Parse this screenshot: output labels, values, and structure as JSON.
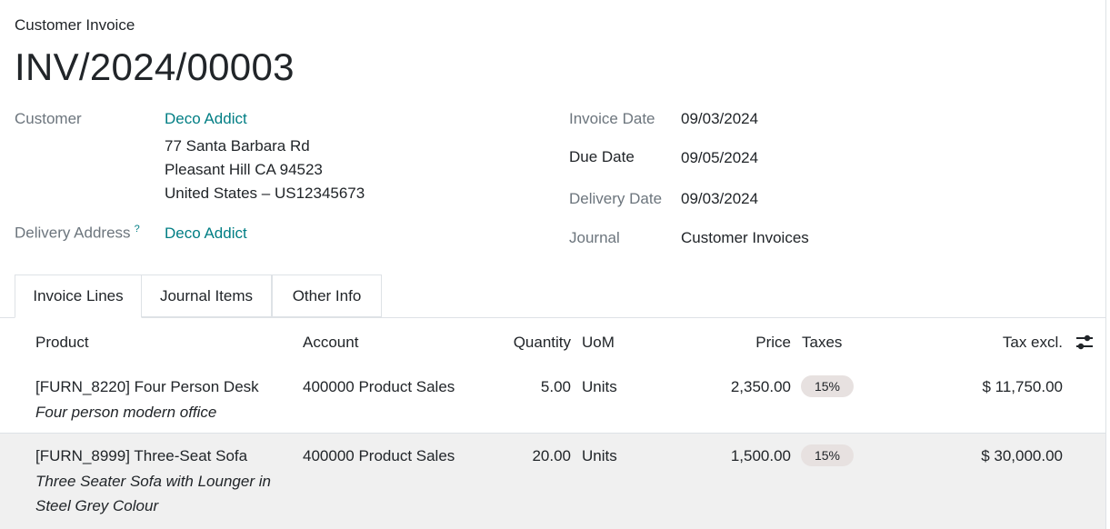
{
  "header": {
    "doc_kind": "Customer Invoice",
    "doc_name": "INV/2024/00003"
  },
  "customer": {
    "label": "Customer",
    "name": "Deco Addict",
    "address_line1": "77 Santa Barbara Rd",
    "address_line2": "Pleasant Hill CA 94523",
    "address_line3": "United States – US12345673"
  },
  "delivery_address": {
    "label": "Delivery Address",
    "help": "?",
    "value": "Deco Addict"
  },
  "invoice_date": {
    "label": "Invoice Date",
    "value": "09/03/2024"
  },
  "due_date": {
    "label": "Due Date",
    "value": "09/05/2024"
  },
  "delivery_date": {
    "label": "Delivery Date",
    "value": "09/03/2024"
  },
  "journal": {
    "label": "Journal",
    "value": "Customer Invoices"
  },
  "tabs": [
    {
      "label": "Invoice Lines",
      "active": true
    },
    {
      "label": "Journal Items",
      "active": false
    },
    {
      "label": "Other Info",
      "active": false
    }
  ],
  "table": {
    "columns": {
      "product": "Product",
      "account": "Account",
      "quantity": "Quantity",
      "uom": "UoM",
      "price": "Price",
      "taxes": "Taxes",
      "tax_excl": "Tax excl."
    },
    "settings_icon": "sliders-icon",
    "rows": [
      {
        "product": "[FURN_8220] Four Person Desk",
        "description": "Four person modern office",
        "account": "400000 Product Sales",
        "quantity": "5.00",
        "uom": "Units",
        "price": "2,350.00",
        "tax": "15%",
        "subtotal": "$ 11,750.00"
      },
      {
        "product": "[FURN_8999] Three-Seat Sofa",
        "description": "Three Seater Sofa with Lounger in Steel Grey Colour",
        "account": "400000 Product Sales",
        "quantity": "20.00",
        "uom": "Units",
        "price": "1,500.00",
        "tax": "15%",
        "subtotal": "$ 30,000.00"
      }
    ]
  },
  "colors": {
    "link": "#017e84",
    "muted_label": "#6c757d",
    "badge_bg": "#e7e1e0",
    "selected_row_bg": "#f0f0f0"
  }
}
